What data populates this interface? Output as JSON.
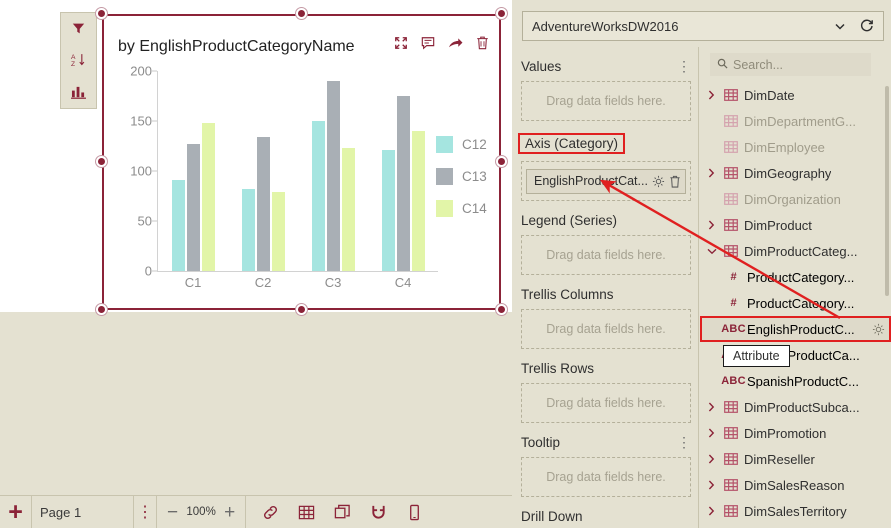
{
  "chart_data": {
    "type": "bar",
    "title": "by EnglishProductCategoryName",
    "categories": [
      "C1",
      "C2",
      "C3",
      "C4"
    ],
    "series": [
      {
        "name": "C12",
        "color": "#a5e5e0",
        "values": [
          91,
          82,
          150,
          121
        ]
      },
      {
        "name": "C13",
        "color": "#a9afb5",
        "values": [
          127,
          134,
          190,
          175
        ]
      },
      {
        "name": "C14",
        "color": "#e2f5a8",
        "values": [
          148,
          79,
          123,
          140
        ]
      }
    ],
    "ylim": [
      0,
      200
    ],
    "yticks": [
      0,
      50,
      100,
      150,
      200
    ],
    "xlabel": "",
    "ylabel": "",
    "grid": false,
    "legend_position": "right"
  },
  "chart_panel": {
    "title": "by EnglishProductCategoryName",
    "tools": [
      {
        "name": "maximize-icon",
        "label": "Maximize"
      },
      {
        "name": "comment-icon",
        "label": "Comment"
      },
      {
        "name": "share-icon",
        "label": "Share"
      },
      {
        "name": "delete-icon",
        "label": "Delete"
      }
    ]
  },
  "widget_toolbar": {
    "items": [
      {
        "name": "filter-icon",
        "label": "Filter"
      },
      {
        "name": "sort-az-icon",
        "label": "Sort"
      },
      {
        "name": "chart-type-icon",
        "label": "Chart type"
      }
    ]
  },
  "bottom_bar": {
    "add_label": "+",
    "page_label": "Page 1",
    "page_kebab": "⋮",
    "zoom_out": "−",
    "zoom_value": "100%",
    "zoom_in": "+",
    "icons": [
      {
        "name": "link-icon",
        "label": "Link"
      },
      {
        "name": "grid-icon",
        "label": "Grid"
      },
      {
        "name": "layers-icon",
        "label": "Layers"
      },
      {
        "name": "magnet-icon",
        "label": "Snap"
      },
      {
        "name": "mobile-icon",
        "label": "Mobile layout"
      }
    ]
  },
  "datasource": {
    "name": "AdventureWorksDW2016",
    "chevron": "chevron-down-icon",
    "refresh": "refresh-icon"
  },
  "search": {
    "placeholder": "Search...",
    "value": "",
    "icon": "search-icon"
  },
  "bindings": {
    "wells": [
      {
        "title": "Values",
        "kebab": true,
        "highlight": false,
        "placeholder": "Drag data fields here.",
        "field": null
      },
      {
        "title": "Axis (Category)",
        "kebab": false,
        "highlight": true,
        "placeholder": "Drag data fields here.",
        "field": "EnglishProductCat..."
      },
      {
        "title": "Legend (Series)",
        "kebab": false,
        "highlight": false,
        "placeholder": "Drag data fields here.",
        "field": null
      },
      {
        "title": "Trellis Columns",
        "kebab": false,
        "highlight": false,
        "placeholder": "Drag data fields here.",
        "field": null
      },
      {
        "title": "Trellis Rows",
        "kebab": false,
        "highlight": false,
        "placeholder": "Drag data fields here.",
        "field": null
      },
      {
        "title": "Tooltip",
        "kebab": true,
        "highlight": false,
        "placeholder": "Drag data fields here.",
        "field": null
      },
      {
        "title": "Drill Down",
        "kebab": false,
        "highlight": false,
        "placeholder": null,
        "field": null
      }
    ],
    "field_settings_icon": "gear-icon",
    "field_delete_icon": "trash-icon"
  },
  "tree": {
    "nodes": [
      {
        "label": "DimDate",
        "type": "table",
        "expander": "collapsed",
        "muted": false,
        "indent": 0
      },
      {
        "label": "DimDepartmentG...",
        "type": "table",
        "expander": "none",
        "muted": true,
        "indent": 0
      },
      {
        "label": "DimEmployee",
        "type": "table",
        "expander": "none",
        "muted": true,
        "indent": 0
      },
      {
        "label": "DimGeography",
        "type": "table",
        "expander": "collapsed",
        "muted": false,
        "indent": 0
      },
      {
        "label": "DimOrganization",
        "type": "table",
        "expander": "none",
        "muted": true,
        "indent": 0
      },
      {
        "label": "DimProduct",
        "type": "table",
        "expander": "collapsed",
        "muted": false,
        "indent": 0
      },
      {
        "label": "DimProductCateg...",
        "type": "table",
        "expander": "expanded",
        "muted": false,
        "indent": 0
      },
      {
        "label": "ProductCategory...",
        "type": "number",
        "expander": "none",
        "muted": false,
        "indent": 1
      },
      {
        "label": "ProductCategory...",
        "type": "number",
        "expander": "none",
        "muted": false,
        "indent": 1
      },
      {
        "label": "EnglishProductC...",
        "type": "text",
        "expander": "none",
        "muted": false,
        "indent": 1,
        "selected": true,
        "highlight": true,
        "gear": true
      },
      {
        "label": "FrenchProductCa...",
        "type": "text",
        "expander": "none",
        "muted": false,
        "indent": 1
      },
      {
        "label": "SpanishProductC...",
        "type": "text",
        "expander": "none",
        "muted": false,
        "indent": 1
      },
      {
        "label": "DimProductSubca...",
        "type": "table",
        "expander": "collapsed",
        "muted": false,
        "indent": 0
      },
      {
        "label": "DimPromotion",
        "type": "table",
        "expander": "collapsed",
        "muted": false,
        "indent": 0
      },
      {
        "label": "DimReseller",
        "type": "table",
        "expander": "collapsed",
        "muted": false,
        "indent": 0
      },
      {
        "label": "DimSalesReason",
        "type": "table",
        "expander": "collapsed",
        "muted": false,
        "indent": 0
      },
      {
        "label": "DimSalesTerritory",
        "type": "table",
        "expander": "collapsed",
        "muted": false,
        "indent": 0
      }
    ],
    "icon_number": "#",
    "icon_text": "ABC"
  },
  "tooltip": {
    "text": "Attribute"
  },
  "colors": {
    "accent": "#8b2338",
    "panel_bg": "#e4e1d1",
    "highlight_red": "#e02020",
    "series_1": "#a5e5e0",
    "series_2": "#a9afb5",
    "series_3": "#e2f5a8"
  }
}
